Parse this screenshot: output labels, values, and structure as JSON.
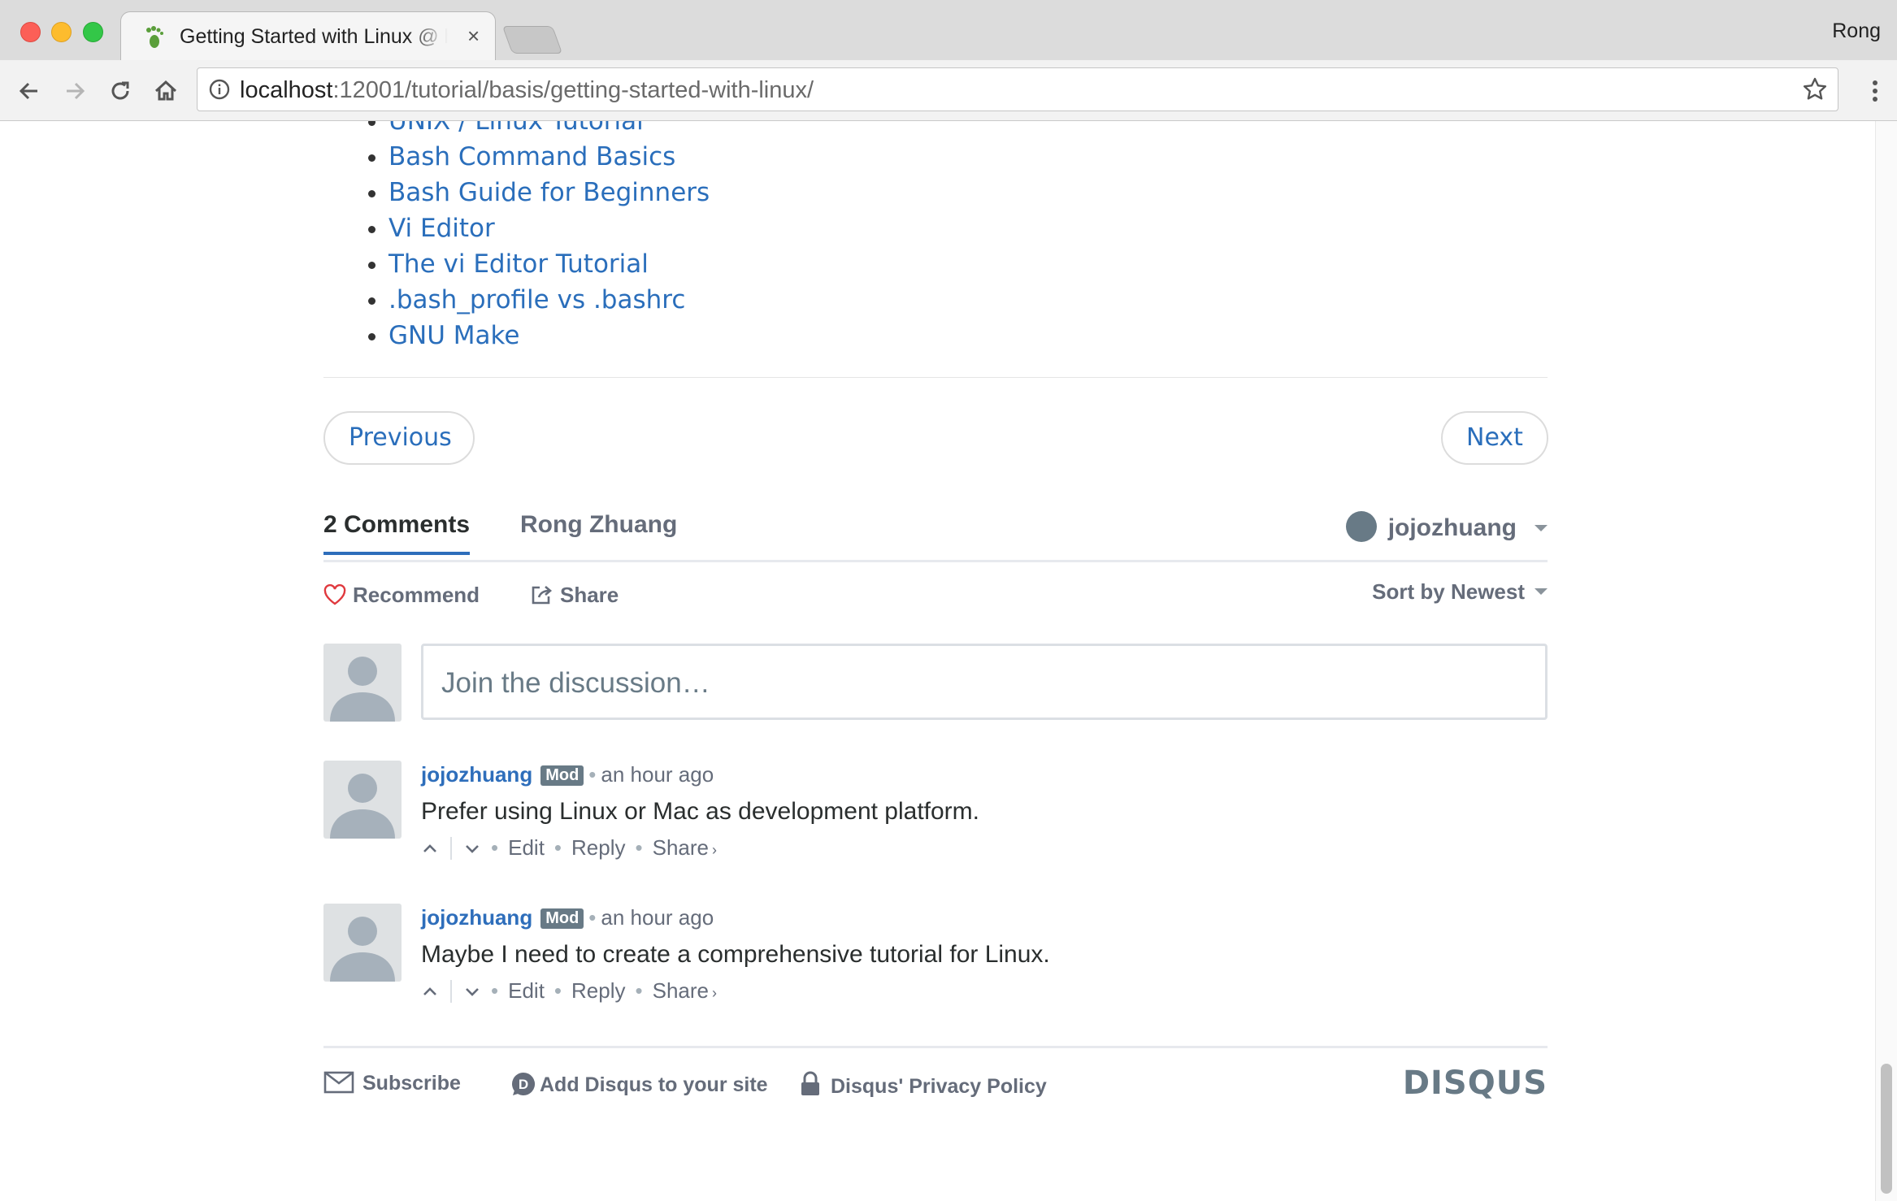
{
  "browser": {
    "tab_title": "Getting Started with Linux @ h",
    "tab_close": "×",
    "profile_name": "Rong",
    "url_host": "localhost",
    "url_rest": ":12001/tutorial/basis/getting-started-with-linux/"
  },
  "links": [
    "UNIX / Linux Tutorial",
    "Bash Command Basics",
    "Bash Guide for Beginners",
    "Vi Editor",
    "The vi Editor Tutorial",
    ".bash_profile vs .bashrc",
    "GNU Make"
  ],
  "pager": {
    "previous": "Previous",
    "next": "Next"
  },
  "disqus": {
    "comments_tab": "2 Comments",
    "forum_tab": "Rong Zhuang",
    "user": "jojozhuang",
    "recommend": "Recommend",
    "share": "Share",
    "sort": "Sort by Newest",
    "compose_placeholder": "Join the discussion…",
    "comments": [
      {
        "author": "jojozhuang",
        "badge": "Mod",
        "time": "an hour ago",
        "text": "Prefer using Linux or Mac as development platform.",
        "edit": "Edit",
        "reply": "Reply",
        "share": "Share"
      },
      {
        "author": "jojozhuang",
        "badge": "Mod",
        "time": "an hour ago",
        "text": "Maybe I need to create a comprehensive tutorial for Linux.",
        "edit": "Edit",
        "reply": "Reply",
        "share": "Share"
      }
    ],
    "footer": {
      "subscribe": "Subscribe",
      "add_disqus": "Add Disqus to your site",
      "privacy": "Disqus' Privacy Policy",
      "logo": "DISQUS"
    }
  },
  "colors": {
    "link": "#2a6ebb",
    "accent": "#2e9fff",
    "muted": "#656c7a"
  }
}
